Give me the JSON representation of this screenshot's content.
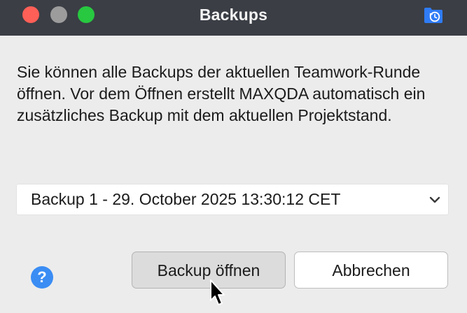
{
  "window": {
    "title": "Backups"
  },
  "dialog": {
    "message": "Sie können alle Backups der aktuellen Teamwork-Runde öffnen. Vor dem Öffnen erstellt MAXQDA automatisch ein zusätzliches Backup mit dem aktuellen Projektstand.",
    "backup_select": {
      "value": "Backup 1 - 29. October 2025 13:30:12 CET"
    },
    "help_label": "?",
    "buttons": {
      "open_label": "Backup öffnen",
      "cancel_label": "Abbrechen"
    }
  },
  "icons": {
    "close": "close-dot",
    "minimize": "minimize-dot",
    "maximize": "maximize-dot",
    "title_icon": "folder-history-icon",
    "chevron": "chevron-down-icon",
    "help": "help-icon",
    "cursor": "mouse-pointer-icon"
  },
  "colors": {
    "titlebar": "#3b3e45",
    "close": "#fe5f57",
    "minimize": "#9c9c9c",
    "maximize": "#28c840",
    "help": "#3b8df4",
    "title_icon": "#2f7cf6"
  }
}
